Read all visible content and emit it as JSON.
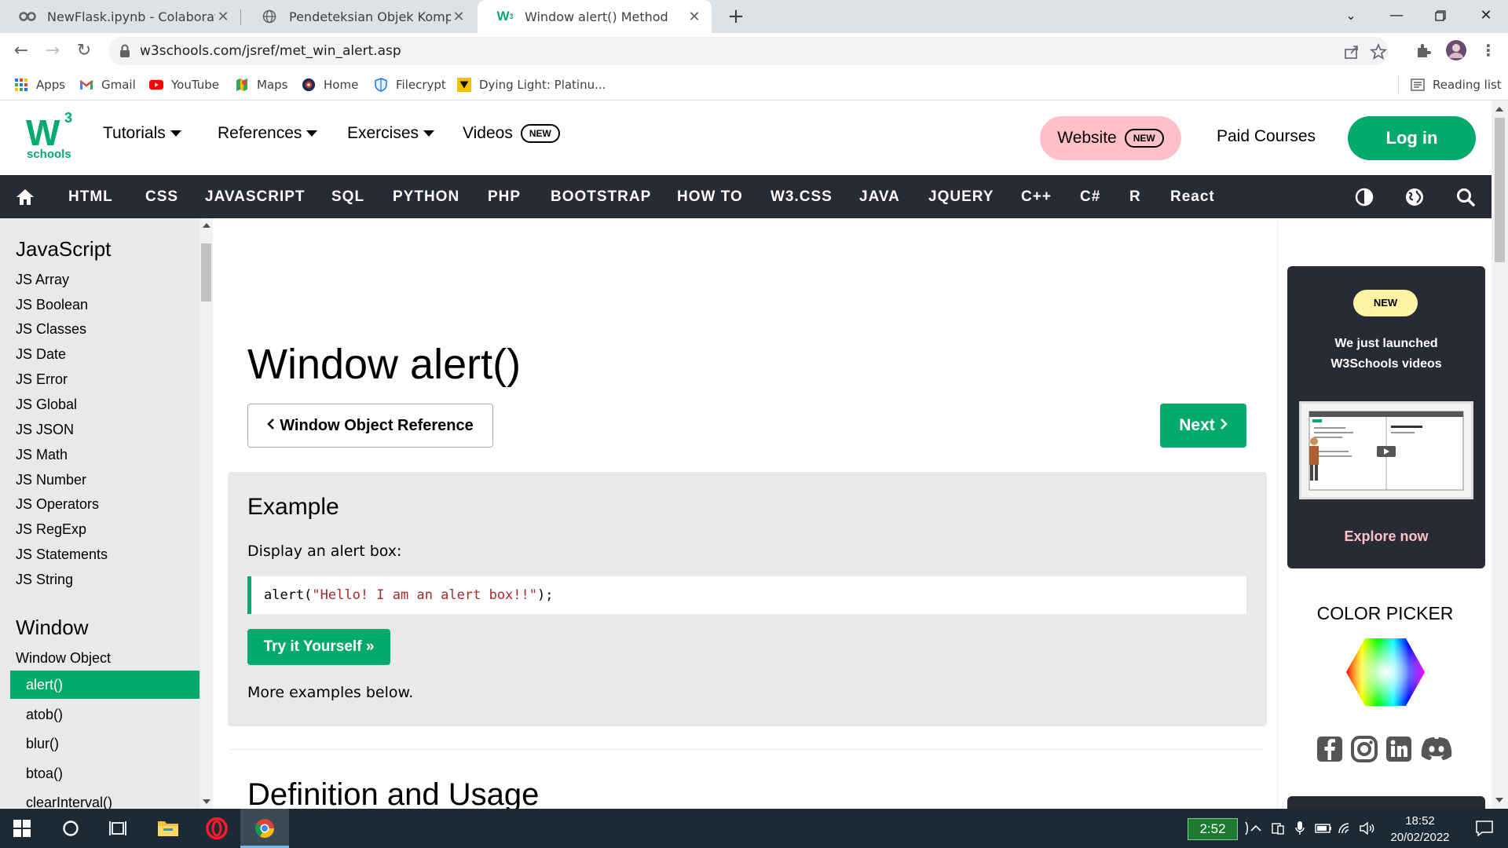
{
  "browser": {
    "tabs": [
      {
        "title": "NewFlask.ipynb - Colaboratory",
        "icon": "colab-icon"
      },
      {
        "title": "Pendeteksian Objek Komponen P",
        "icon": "globe-icon"
      },
      {
        "title": "Window alert() Method",
        "icon": "w3schools-icon",
        "active": true
      }
    ],
    "url": "w3schools.com/jsref/met_win_alert.asp",
    "bookmarks": [
      {
        "label": "Apps",
        "icon": "apps-grid-icon"
      },
      {
        "label": "Gmail",
        "icon": "gmail-icon"
      },
      {
        "label": "YouTube",
        "icon": "youtube-icon"
      },
      {
        "label": "Maps",
        "icon": "maps-icon"
      },
      {
        "label": "Home",
        "icon": "home-bookmark-icon"
      },
      {
        "label": "Filecrypt",
        "icon": "shield-icon"
      },
      {
        "label": "Dying Light: Platinu...",
        "icon": "game-icon"
      }
    ],
    "reading_list": "Reading list"
  },
  "w3": {
    "logo": {
      "mark": "W",
      "sup": "3",
      "text": "schools"
    },
    "nav": {
      "tutorials": "Tutorials",
      "references": "References",
      "exercises": "Exercises",
      "videos": "Videos",
      "new_badge": "NEW",
      "website": "Website",
      "paid_courses": "Paid Courses",
      "login": "Log in"
    },
    "topnav": [
      "HTML",
      "CSS",
      "JAVASCRIPT",
      "SQL",
      "PYTHON",
      "PHP",
      "BOOTSTRAP",
      "HOW TO",
      "W3.CSS",
      "JAVA",
      "JQUERY",
      "C++",
      "C#",
      "R",
      "React"
    ]
  },
  "sidebar": {
    "heading1": "JavaScript",
    "js_items": [
      "JS Array",
      "JS Boolean",
      "JS Classes",
      "JS Date",
      "JS Error",
      "JS Global",
      "JS JSON",
      "JS Math",
      "JS Number",
      "JS Operators",
      "JS RegExp",
      "JS Statements",
      "JS String"
    ],
    "heading2": "Window",
    "window_object": "Window Object",
    "window_items": [
      "alert()",
      "atob()",
      "blur()",
      "btoa()",
      "clearInterval()"
    ],
    "selected": "alert()"
  },
  "main": {
    "title": "Window alert()",
    "prev_label": "Window Object Reference",
    "next_label": "Next",
    "example": {
      "title": "Example",
      "desc": "Display an alert box:",
      "code_fn": "alert(",
      "code_str": "\"Hello! I am an alert box!!\"",
      "code_end": ");",
      "try_label": "Try it Yourself »",
      "more": "More examples below."
    },
    "section2": "Definition and Usage"
  },
  "right": {
    "badge": "NEW",
    "promo_line1": "We just launched",
    "promo_line2": "W3Schools videos",
    "explore": "Explore now",
    "color_picker": "COLOR PICKER"
  },
  "taskbar": {
    "battery_time": "2:52",
    "time": "18:52",
    "date": "20/02/2022"
  },
  "colors": {
    "brand_green": "#04AA6D",
    "nav_dark": "#282A35",
    "pink": "#FFC0C7",
    "sidebar_bg": "#E7E9EB"
  }
}
